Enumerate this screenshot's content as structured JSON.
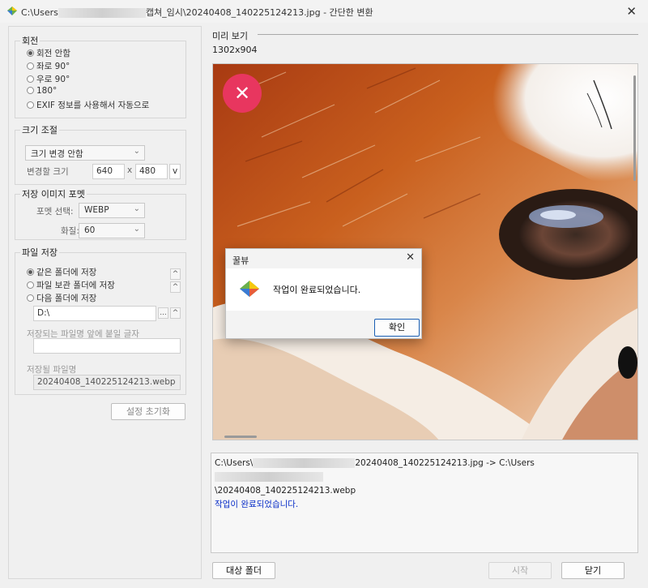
{
  "window": {
    "path_prefix": "C:\\Users",
    "path_suffix": "캡쳐_임시\\20240408_140225124213.jpg - 간단한 변환",
    "close_glyph": "✕"
  },
  "rotation": {
    "title": "회전",
    "options": [
      "회전 안함",
      "좌로 90°",
      "우로 90°",
      "180°",
      "EXIF 정보를 사용해서 자동으로"
    ],
    "selected": 0
  },
  "resize": {
    "title": "크기 조절",
    "mode": "크기 변경 안함",
    "size_label": "변경할 크기",
    "width": "640",
    "x_label": "x",
    "height": "480",
    "dropdown": "v"
  },
  "format": {
    "title": "저장 이미지 포멧",
    "format_label": "포멧 선택:",
    "format_value": "WEBP",
    "quality_label": "화질:",
    "quality_value": "60"
  },
  "save": {
    "title": "파일 저장",
    "options": [
      "같은 폴더에 저장",
      "파일 보관 폴더에 저장",
      "다음 폴더에 저장"
    ],
    "selected": 0,
    "folder": "D:\\",
    "browse_label": "...",
    "prefix_label": "저장되는 파일명 앞에 붙일 글자",
    "prefix_value": "",
    "filename_label": "저장될 파일명",
    "filename_value": "20240408_140225124213.webp"
  },
  "reset_button": "설정 초기화",
  "preview": {
    "title": "미리 보기",
    "size": "1302x904",
    "badge_glyph": "✕",
    "badge_color": "#e8365f"
  },
  "log": {
    "line1_start": "C:\\Users\\",
    "line1_mid": "20240408_140225124213.jpg -> C:\\Users",
    "line2": "\\20240408_140225124213.webp",
    "line3": "작업이 완료되었습니다."
  },
  "dialog": {
    "title": "꿀뷰",
    "close_glyph": "✕",
    "message": "작업이 완료되었습니다.",
    "ok": "확인"
  },
  "bottom": {
    "target_folder": "대상 폴더",
    "start": "시작",
    "close": "닫기"
  }
}
